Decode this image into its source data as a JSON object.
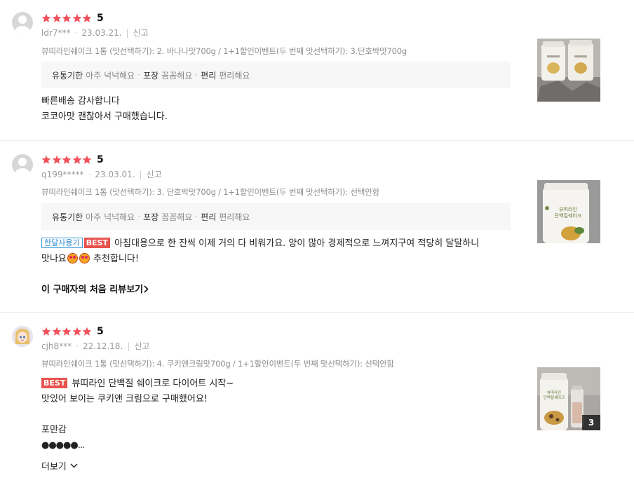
{
  "colors": {
    "star": "#f0515b",
    "best_badge": "#e8534d",
    "month_badge": "#2e8ad0"
  },
  "reviews": [
    {
      "rating": "5",
      "user": "ldr7***",
      "date": "23.03.21.",
      "report": "신고",
      "option": "뷰띠라인쉐이크 1통 (맛선택하기): 2. 바나나맛700g / 1+1할인이벤트(두 번째 맛선택하기): 3.단호박맛700g",
      "attrs": [
        {
          "key": "유통기한",
          "value": "아주 넉넉해요"
        },
        {
          "key": "포장",
          "value": "꼼꼼해요"
        },
        {
          "key": "편리",
          "value": "편리해요"
        }
      ],
      "lines": [
        "빠른배송 감사합니다",
        "코코아맛 괜찮아서 구매했습니다."
      ]
    },
    {
      "rating": "5",
      "user": "q199*****",
      "date": "23.03.01.",
      "report": "신고",
      "option": "뷰띠라인쉐이크 1통 (맛선택하기): 3. 단호박맛700g / 1+1할인이벤트(두 번째 맛선택하기): 선택안함",
      "attrs": [
        {
          "key": "유통기한",
          "value": "아주 넉넉해요"
        },
        {
          "key": "포장",
          "value": "꼼꼼해요"
        },
        {
          "key": "편리",
          "value": "편리해요"
        }
      ],
      "badge_month": "한달사용기",
      "badge_best": "BEST",
      "line1": "아침대용으로 한 잔씩 이제 거의 다 비워가요. 양이 많아 경제적으로 느껴지구여 적당히 달달하니",
      "line2a": "맛나요",
      "line2b": "추천합니다!",
      "first_review_link": "이 구매자의 처음 리뷰보기"
    },
    {
      "rating": "5",
      "user": "cjh8***",
      "date": "22.12.18.",
      "report": "신고",
      "option": "뷰띠라인쉐이크 1통 (맛선택하기): 4. 쿠키앤크림맛700g / 1+1할인이벤트(두 번째 맛선택하기): 선택안함",
      "badge_best": "BEST",
      "line1": "뷰띠라인 단백질 쉐이크로 다이어트 시작~",
      "line2": "맛있어 보이는 쿠키앤 크림으로 구매했어요!",
      "line3": "포만감",
      "line4": "●●●●●...",
      "more": "더보기",
      "image_count": "3"
    }
  ]
}
